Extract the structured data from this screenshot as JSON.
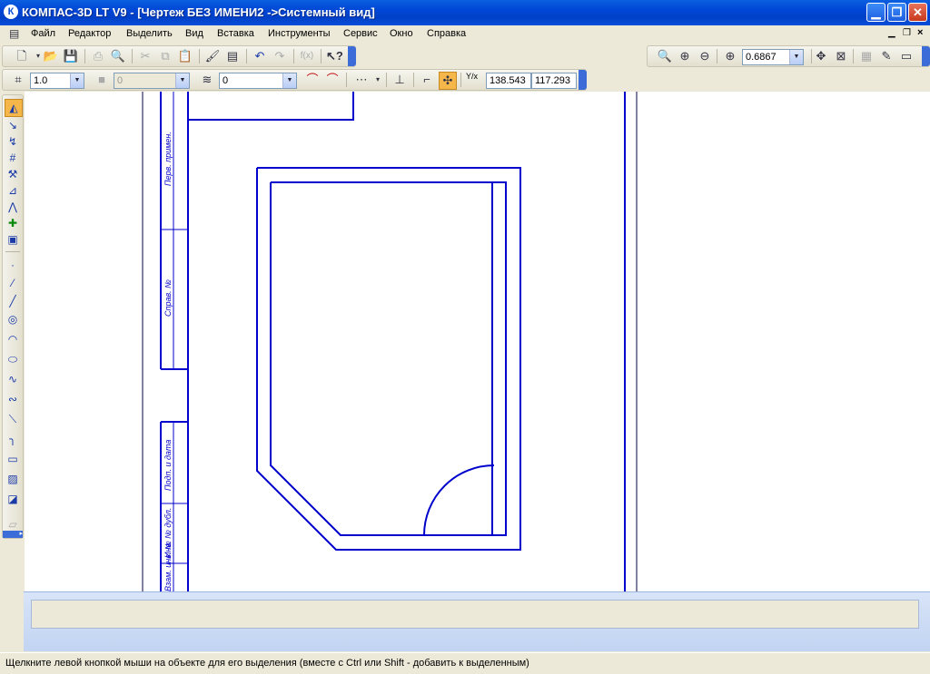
{
  "window": {
    "title": "КОМПАС-3D LT V9 - [Чертеж БЕЗ ИМЕНИ2 ->Системный вид]",
    "app_icon": "К"
  },
  "menu": [
    "Файл",
    "Редактор",
    "Выделить",
    "Вид",
    "Вставка",
    "Инструменты",
    "Сервис",
    "Окно",
    "Справка"
  ],
  "toolbar_view": {
    "zoom_value": "0.6867"
  },
  "toolbar_current_state": {
    "step": "1.0",
    "style": "0",
    "layer": "0",
    "coord_label": "Y/x",
    "coord_x": "138.543",
    "coord_y": "117.293"
  },
  "drawing_stamp": {
    "label_1": "Перв. примен.",
    "label_2": "Справ. №",
    "label_3": "Подп. и дата",
    "label_4": "Инв. № дубл.",
    "label_5": "Взам. инв. №"
  },
  "status": {
    "message": "Щелкните левой кнопкой мыши на объекте для его выделения (вместе с Ctrl или Shift - добавить к выделенным)"
  },
  "colors": {
    "drawing_line": "#0000CC",
    "frame_line": "#000080",
    "titlebar": "#0046D5"
  }
}
